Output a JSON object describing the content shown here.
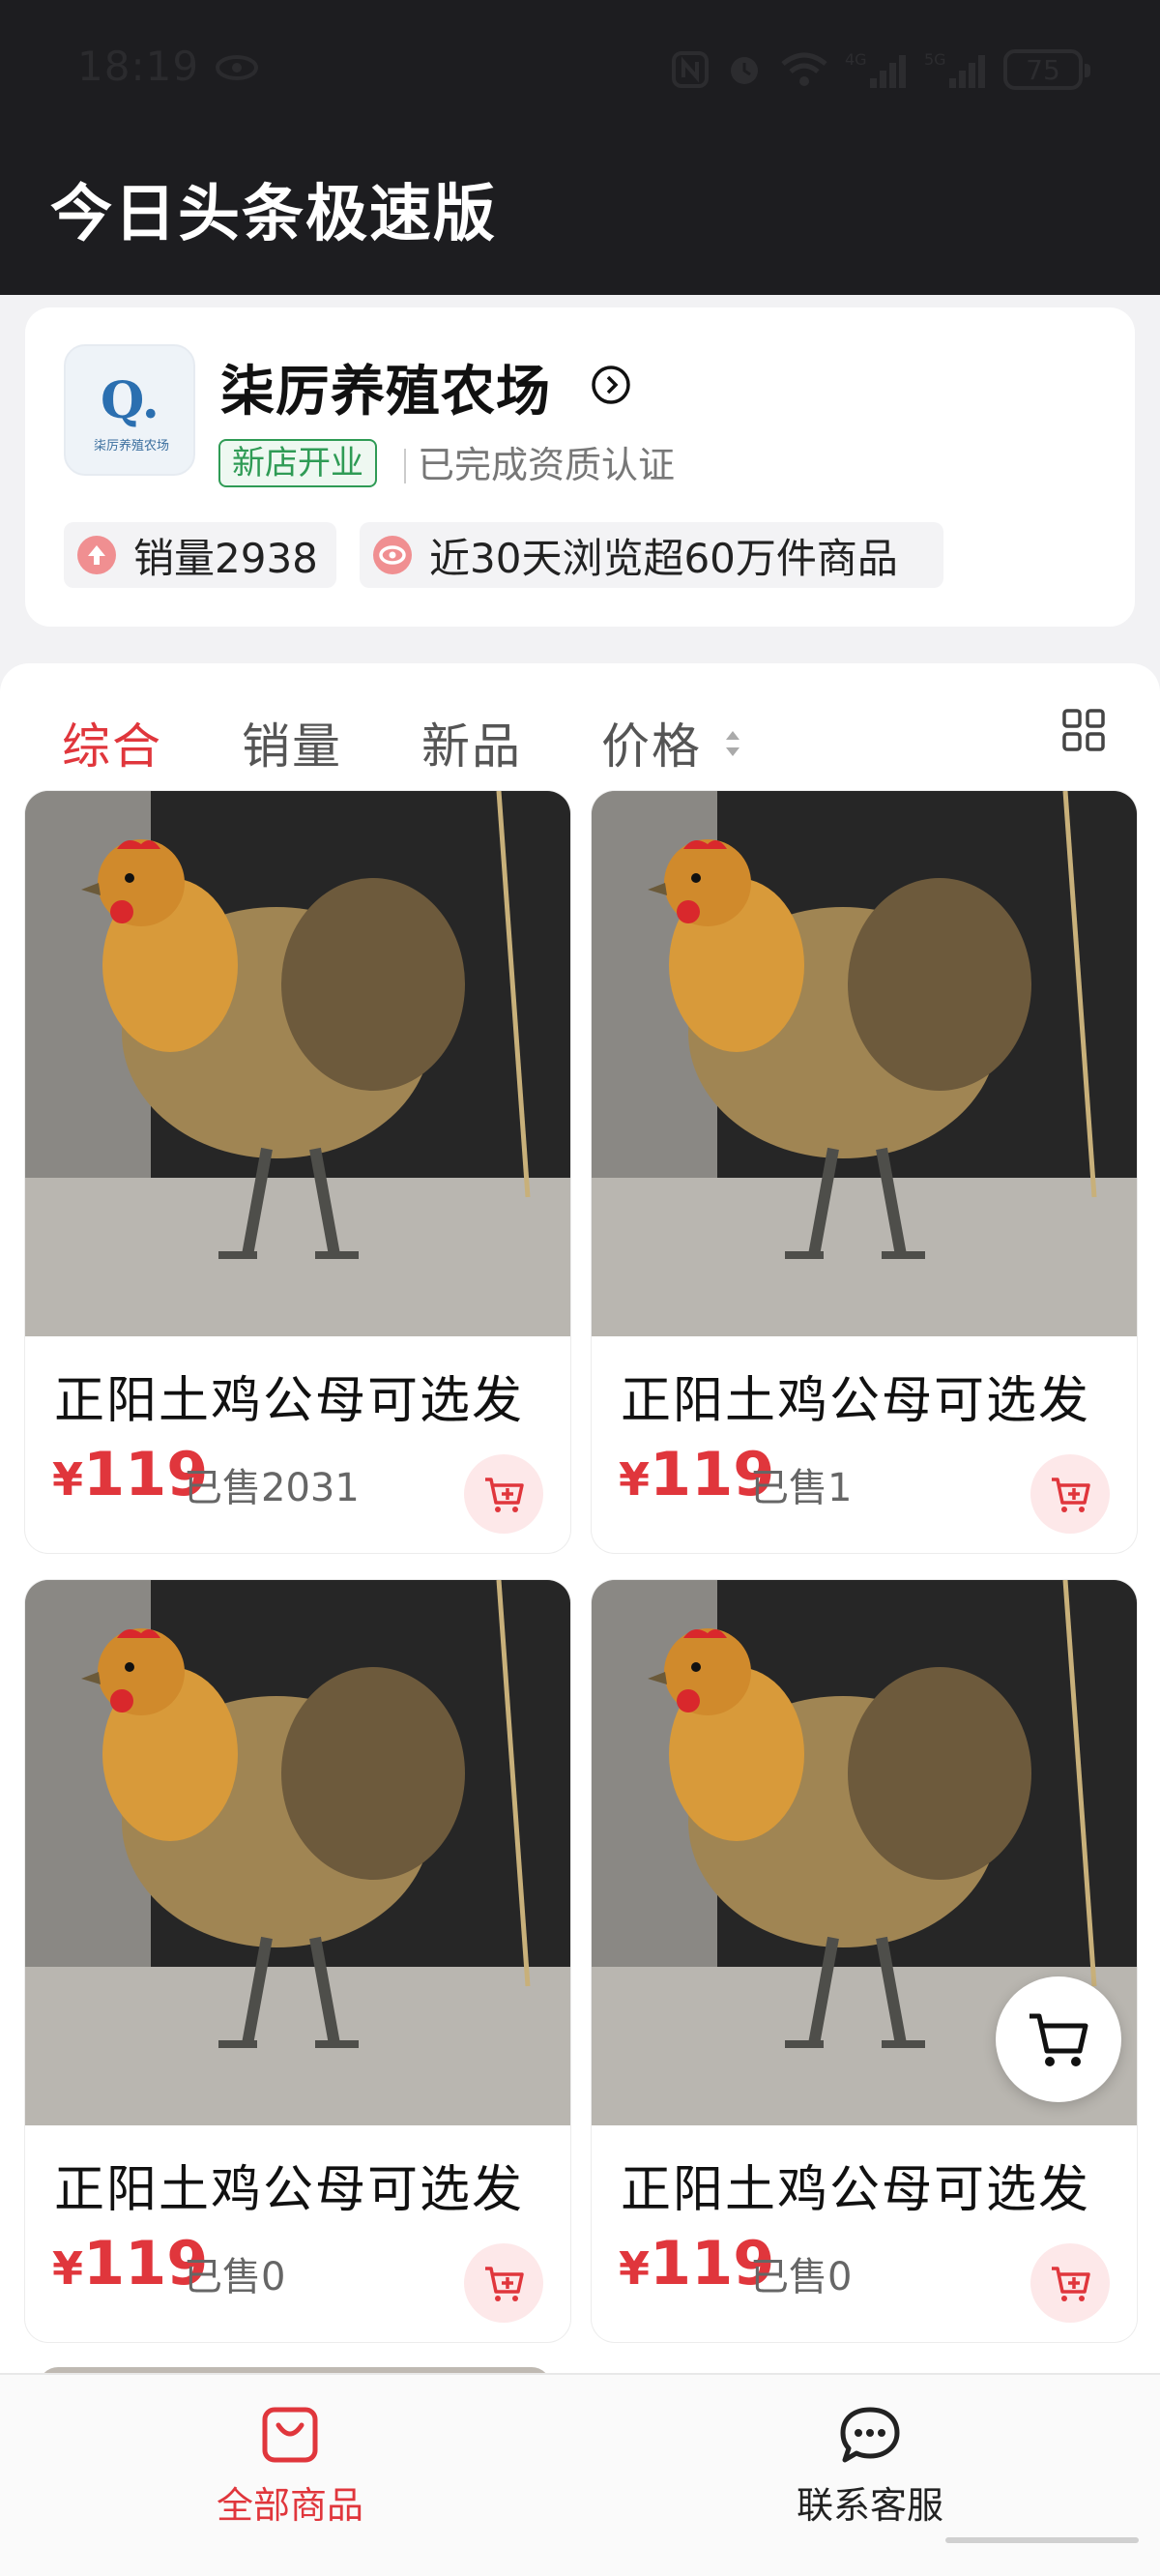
{
  "status_bar": {
    "time": "18:19",
    "battery": "75",
    "icons": [
      "eye-icon",
      "nfc-icon",
      "alarm-icon",
      "wifi-icon",
      "signal-4g-icon",
      "signal-5g-icon",
      "battery-icon"
    ]
  },
  "app": {
    "title": "今日头条极速版"
  },
  "shop": {
    "name": "柒厉养殖农场",
    "logo_letter": "Q.",
    "logo_caption": "柒厉养殖农场",
    "badge": "新店开业",
    "certification": "已完成资质认证",
    "stat_sales": "销量2938",
    "stat_views": "近30天浏览超60万件商品"
  },
  "tabs": [
    {
      "label": "综合",
      "active": true
    },
    {
      "label": "销量"
    },
    {
      "label": "新品"
    },
    {
      "label": "价格"
    }
  ],
  "products": [
    {
      "title": "正阳土鸡公母可选发",
      "currency": "¥",
      "price": "119",
      "sold": "已售2031"
    },
    {
      "title": "正阳土鸡公母可选发",
      "currency": "¥",
      "price": "119",
      "sold": "已售1"
    },
    {
      "title": "正阳土鸡公母可选发",
      "currency": "¥",
      "price": "119",
      "sold": "已售0"
    },
    {
      "title": "正阳土鸡公母可选发",
      "currency": "¥",
      "price": "119",
      "sold": "已售0"
    }
  ],
  "bottom_nav": {
    "all_products": "全部商品",
    "contact_service": "联系客服"
  },
  "colors": {
    "accent": "#e0363c",
    "badge_green": "#2f9b55",
    "header_bg": "#1d1d20"
  }
}
